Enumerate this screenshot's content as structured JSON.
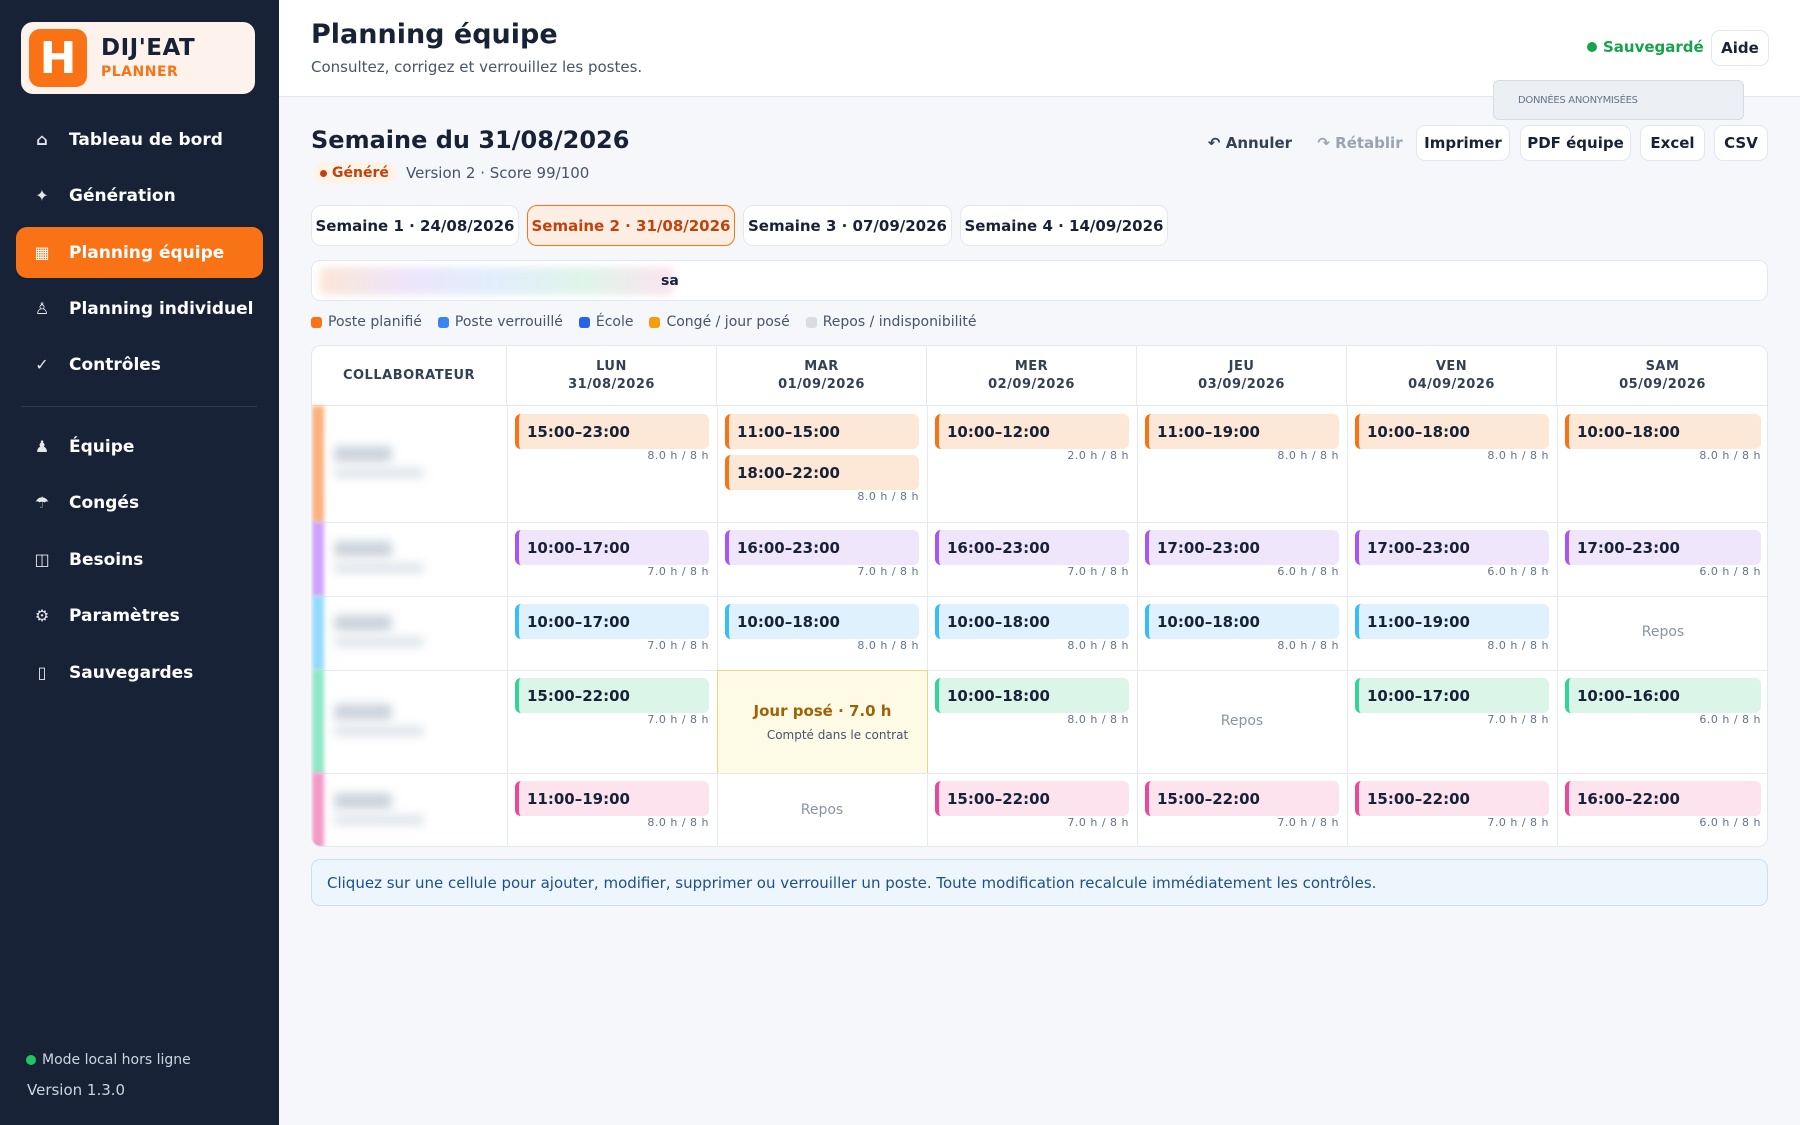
{
  "app": {
    "name": "DIJ'EAT",
    "subname": "PLANNER",
    "logo_letter": "H"
  },
  "sidebar": {
    "items": [
      {
        "label": "Tableau de bord",
        "icon": "home-icon"
      },
      {
        "label": "Génération",
        "icon": "sparkle-icon"
      },
      {
        "label": "Planning équipe",
        "icon": "calendar-grid-icon",
        "active": true
      },
      {
        "label": "Planning individuel",
        "icon": "person-icon"
      },
      {
        "label": "Contrôles",
        "icon": "check-icon"
      },
      {
        "label": "Équipe",
        "icon": "people-icon"
      },
      {
        "label": "Congés",
        "icon": "umbrella-icon"
      },
      {
        "label": "Besoins",
        "icon": "columns-icon"
      },
      {
        "label": "Paramètres",
        "icon": "gear-icon"
      },
      {
        "label": "Sauvegardes",
        "icon": "save-icon"
      }
    ],
    "mode": "Mode local hors ligne",
    "version": "Version 1.3.0"
  },
  "header": {
    "title": "Planning équipe",
    "subtitle": "Consultez, corrigez et verrouillez les postes.",
    "saved": "Sauvegardé",
    "help": "Aide",
    "anon_badge": "DONNÉES ANONYMISÉES"
  },
  "week": {
    "title": "Semaine du 31/08/2026",
    "status": "Généré",
    "version_score": "Version 2 · Score 99/100"
  },
  "toolbar": {
    "undo": "↶ Annuler",
    "redo": "↷ Rétablir",
    "print": "Imprimer",
    "pdf": "PDF équipe",
    "excel": "Excel",
    "csv": "CSV"
  },
  "week_tabs": [
    {
      "label": "Semaine 1 · 24/08/2026"
    },
    {
      "label": "Semaine 2 · 31/08/2026",
      "active": true
    },
    {
      "label": "Semaine 3 · 07/09/2026"
    },
    {
      "label": "Semaine 4 · 14/09/2026"
    }
  ],
  "search": {
    "visible_text": "sa"
  },
  "legend": [
    {
      "label": "Poste planifié",
      "color": "#f97316"
    },
    {
      "label": "Poste verrouillé",
      "color": "#3b82f6"
    },
    {
      "label": "École",
      "color": "#2563eb"
    },
    {
      "label": "Congé / jour posé",
      "color": "#f59e0b"
    },
    {
      "label": "Repos / indisponibilité",
      "color": "#d9dde3"
    }
  ],
  "table": {
    "collab_header": "COLLABORATEUR",
    "days": [
      {
        "name": "LUN",
        "date": "31/08/2026"
      },
      {
        "name": "MAR",
        "date": "01/09/2026"
      },
      {
        "name": "MER",
        "date": "02/09/2026"
      },
      {
        "name": "JEU",
        "date": "03/09/2026"
      },
      {
        "name": "VEN",
        "date": "04/09/2026"
      },
      {
        "name": "SAM",
        "date": "05/09/2026"
      }
    ],
    "rows": [
      {
        "color": "#f97316",
        "bg": "#fde7d6",
        "cells": [
          {
            "type": "shift",
            "shifts": [
              "15:00–23:00"
            ],
            "hours": "8.0 h / 8 h"
          },
          {
            "type": "shift",
            "shifts": [
              "11:00–15:00",
              "18:00–22:00"
            ],
            "hours": "8.0 h / 8 h"
          },
          {
            "type": "shift",
            "shifts": [
              "10:00–12:00"
            ],
            "hours": "2.0 h / 8 h"
          },
          {
            "type": "shift",
            "shifts": [
              "11:00–19:00"
            ],
            "hours": "8.0 h / 8 h"
          },
          {
            "type": "shift",
            "shifts": [
              "10:00–18:00"
            ],
            "hours": "8.0 h / 8 h"
          },
          {
            "type": "shift",
            "shifts": [
              "10:00–18:00"
            ],
            "hours": "8.0 h / 8 h"
          }
        ]
      },
      {
        "color": "#a855f7",
        "bg": "#efe6fc",
        "cells": [
          {
            "type": "shift",
            "shifts": [
              "10:00–17:00"
            ],
            "hours": "7.0 h / 8 h"
          },
          {
            "type": "shift",
            "shifts": [
              "16:00–23:00"
            ],
            "hours": "7.0 h / 8 h"
          },
          {
            "type": "shift",
            "shifts": [
              "16:00–23:00"
            ],
            "hours": "7.0 h / 8 h"
          },
          {
            "type": "shift",
            "shifts": [
              "17:00–23:00"
            ],
            "hours": "6.0 h / 8 h"
          },
          {
            "type": "shift",
            "shifts": [
              "17:00–23:00"
            ],
            "hours": "6.0 h / 8 h"
          },
          {
            "type": "shift",
            "shifts": [
              "17:00–23:00"
            ],
            "hours": "6.0 h / 8 h"
          }
        ]
      },
      {
        "color": "#38bdf8",
        "bg": "#dff1fc",
        "cells": [
          {
            "type": "shift",
            "shifts": [
              "10:00–17:00"
            ],
            "hours": "7.0 h / 8 h"
          },
          {
            "type": "shift",
            "shifts": [
              "10:00–18:00"
            ],
            "hours": "8.0 h / 8 h"
          },
          {
            "type": "shift",
            "shifts": [
              "10:00–18:00"
            ],
            "hours": "8.0 h / 8 h"
          },
          {
            "type": "shift",
            "shifts": [
              "10:00–18:00"
            ],
            "hours": "8.0 h / 8 h"
          },
          {
            "type": "shift",
            "shifts": [
              "11:00–19:00"
            ],
            "hours": "8.0 h / 8 h"
          },
          {
            "type": "rest",
            "label": "Repos"
          }
        ]
      },
      {
        "color": "#34d399",
        "bg": "#dcf5e9",
        "cells": [
          {
            "type": "shift",
            "shifts": [
              "15:00–22:00"
            ],
            "hours": "7.0 h / 8 h"
          },
          {
            "type": "leave",
            "label": "Jour posé · 7.0 h",
            "sub": "Compté dans le contrat"
          },
          {
            "type": "shift",
            "shifts": [
              "10:00–18:00"
            ],
            "hours": "8.0 h / 8 h"
          },
          {
            "type": "rest",
            "label": "Repos"
          },
          {
            "type": "shift",
            "shifts": [
              "10:00–17:00"
            ],
            "hours": "7.0 h / 8 h"
          },
          {
            "type": "shift",
            "shifts": [
              "10:00–16:00"
            ],
            "hours": "6.0 h / 8 h"
          }
        ]
      },
      {
        "color": "#ec4899",
        "bg": "#fce3ee",
        "cells": [
          {
            "type": "shift",
            "shifts": [
              "11:00–19:00"
            ],
            "hours": "8.0 h / 8 h"
          },
          {
            "type": "rest",
            "label": "Repos"
          },
          {
            "type": "shift",
            "shifts": [
              "15:00–22:00"
            ],
            "hours": "7.0 h / 8 h"
          },
          {
            "type": "shift",
            "shifts": [
              "15:00–22:00"
            ],
            "hours": "7.0 h / 8 h"
          },
          {
            "type": "shift",
            "shifts": [
              "15:00–22:00"
            ],
            "hours": "7.0 h / 8 h"
          },
          {
            "type": "shift",
            "shifts": [
              "16:00–22:00"
            ],
            "hours": "6.0 h / 8 h"
          }
        ]
      }
    ]
  },
  "info_text": "Cliquez sur une cellule pour ajouter, modifier, supprimer ou verrouiller un poste. Toute modification recalcule immédiatement les contrôles."
}
